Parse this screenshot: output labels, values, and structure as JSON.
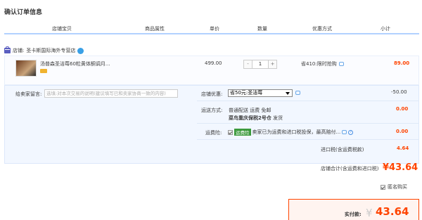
{
  "title": "确认订单信息",
  "headers": [
    "店铺宝贝",
    "商品属性",
    "单价",
    "数量",
    "优惠方式",
    "小计"
  ],
  "store": {
    "label": "店铺:",
    "name": "圣卡斯国际海外专营店"
  },
  "item": {
    "name": "汤普森圣洁莓60粒黄体酮调月...",
    "price": "499.00",
    "quantity": "1",
    "minus": "-",
    "plus": "+",
    "promo": "省410:限时抢购",
    "subtotal": "89.00"
  },
  "message": {
    "label": "给卖家留言:",
    "placeholder": "选填:对本次交易的说明(建议填写已和卖家协商一致的内容)"
  },
  "coupon": {
    "label": "店铺优惠:",
    "value": "省50元:圣洁莓",
    "amount": "-50.00"
  },
  "shipping": {
    "label": "运送方式:",
    "method": "普通配送 运费 免邮",
    "warehouse": "菜鸟重庆保税2号仓",
    "ship_suffix": "发货",
    "amount": "0.00"
  },
  "insurance": {
    "label": "运费险:",
    "tag": "运费险",
    "text": "卖家已为运费和进口税投保，最高赔付...",
    "amount": "0.00"
  },
  "import_tax": {
    "label": "进口税(含运费税款)",
    "amount": "4.64"
  },
  "store_total": {
    "label": "店铺合计(含运费和进口税)",
    "amount": "¥43.64"
  },
  "anonymous": {
    "label": "匿名购买"
  },
  "payment": {
    "label": "实付款:",
    "currency": "¥",
    "amount": "43.64"
  },
  "colors": {
    "accent": "#ff4400",
    "header_border": "#b2d1ff",
    "panel_bg": "#f2f7ff"
  }
}
